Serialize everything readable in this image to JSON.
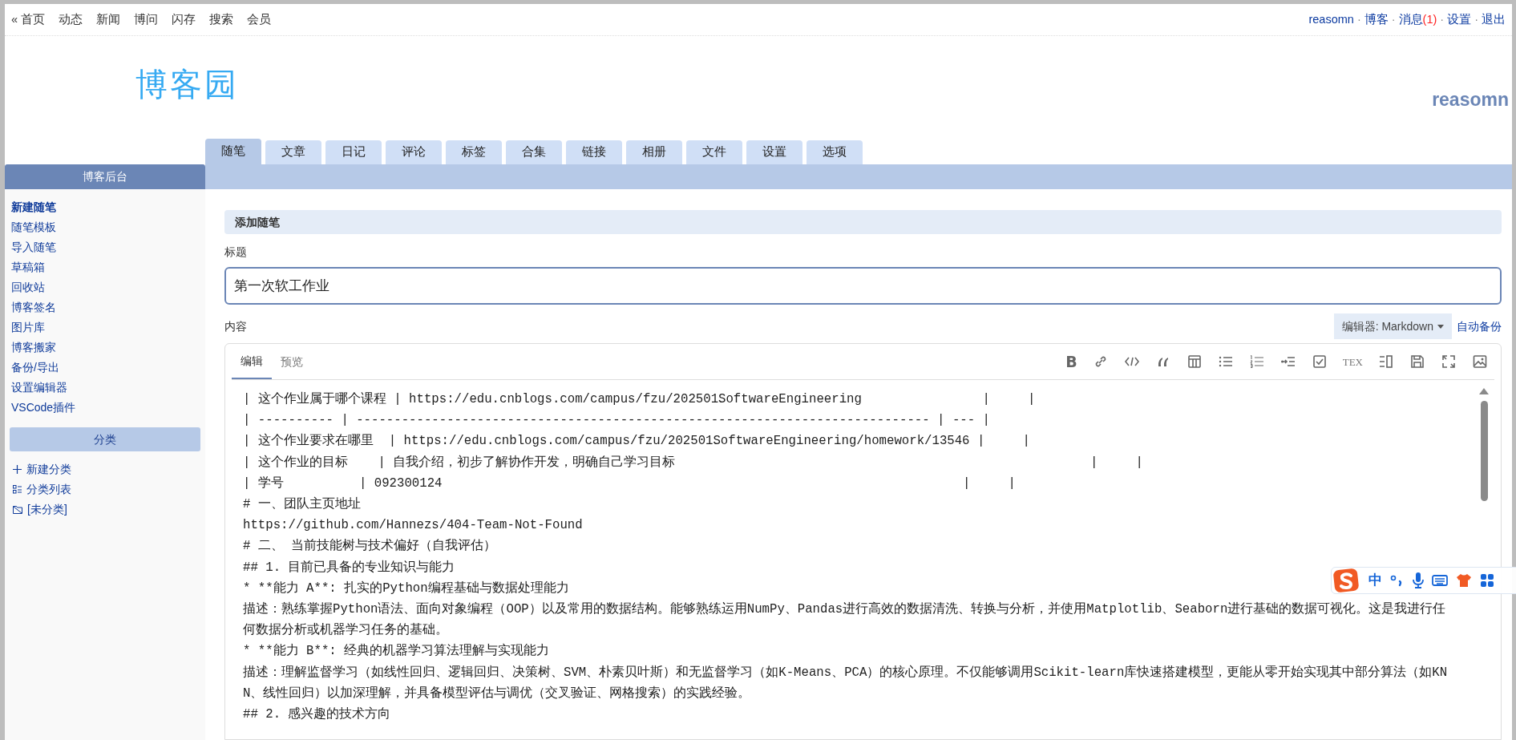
{
  "top_nav": {
    "left": [
      {
        "text": "« 首页"
      },
      {
        "text": "动态"
      },
      {
        "text": "新闻"
      },
      {
        "text": "博问"
      },
      {
        "text": "闪存"
      },
      {
        "text": "搜索"
      },
      {
        "text": "会员"
      }
    ],
    "right": [
      {
        "text": "reasomn"
      },
      {
        "text": "博客"
      },
      {
        "text": "消息",
        "count": "(1)"
      },
      {
        "text": "设置"
      },
      {
        "text": "退出"
      }
    ],
    "separator": "·"
  },
  "header": {
    "logo": "博客园",
    "username": "reasomn"
  },
  "tabs": [
    {
      "label": "随笔",
      "selected": true
    },
    {
      "label": "文章",
      "selected": false
    },
    {
      "label": "日记",
      "selected": false
    },
    {
      "label": "评论",
      "selected": false
    },
    {
      "label": "标签",
      "selected": false
    },
    {
      "label": "合集",
      "selected": false
    },
    {
      "label": "链接",
      "selected": false
    },
    {
      "label": "相册",
      "selected": false
    },
    {
      "label": "文件",
      "selected": false
    },
    {
      "label": "设置",
      "selected": false
    },
    {
      "label": "选项",
      "selected": false
    }
  ],
  "sidebar": {
    "title": "博客后台",
    "items": [
      {
        "label": "新建随笔",
        "selected": true
      },
      {
        "label": "随笔模板",
        "selected": false
      },
      {
        "label": "导入随笔",
        "selected": false
      },
      {
        "label": "草稿箱",
        "selected": false
      },
      {
        "label": "回收站",
        "selected": false
      },
      {
        "label": "博客签名",
        "selected": false
      },
      {
        "label": "图片库",
        "selected": false
      },
      {
        "label": "博客搬家",
        "selected": false
      },
      {
        "label": "备份/导出",
        "selected": false
      },
      {
        "label": "设置编辑器",
        "selected": false
      },
      {
        "label": "VSCode插件",
        "selected": false
      }
    ],
    "category_title": "分类",
    "categories": [
      {
        "kind": "add",
        "label": "新建分类"
      },
      {
        "kind": "list",
        "label": "分类列表"
      },
      {
        "kind": "folder",
        "label": "[未分类]"
      }
    ]
  },
  "form": {
    "section_title": "添加随笔",
    "title_label": "标题",
    "title_value": "第一次软工作业",
    "content_label": "内容",
    "editor_select": "编辑器: Markdown",
    "autosave_link": "自动备份"
  },
  "editor": {
    "tabs": [
      {
        "label": "编辑",
        "selected": true
      },
      {
        "label": "预览",
        "selected": false
      }
    ],
    "toolbar": [
      {
        "kind": "bold",
        "text": "B"
      },
      {
        "kind": "link"
      },
      {
        "kind": "code"
      },
      {
        "kind": "quote"
      },
      {
        "kind": "table"
      },
      {
        "kind": "bullet-list"
      },
      {
        "kind": "numbered-list"
      },
      {
        "kind": "indent"
      },
      {
        "kind": "checkbox"
      },
      {
        "kind": "tex",
        "text": "TEX"
      },
      {
        "kind": "split-view"
      },
      {
        "kind": "save"
      },
      {
        "kind": "fullscreen"
      },
      {
        "kind": "image"
      }
    ],
    "lines": [
      "| 这个作业属于哪个课程 | https://edu.cnblogs.com/campus/fzu/202501SoftwareEngineering                |     |",
      "| ---------- | ---------------------------------------------------------------------------- | --- |",
      "| 这个作业要求在哪里  | https://edu.cnblogs.com/campus/fzu/202501SoftwareEngineering/homework/13546 |     |",
      "| 这个作业的目标    | 自我介绍，初步了解协作开发，明确自己学习目标                                                       |     |",
      "| 学号          | 092300124                                                                     |     |",
      "# 一、团队主页地址",
      "https://github.com/Hannezs/404-Team-Not-Found",
      "# 二、 当前技能树与技术偏好（自我评估）",
      "## 1. 目前已具备的专业知识与能力",
      "* **能力 A**: 扎实的Python编程基础与数据处理能力",
      "描述：熟练掌握Python语法、面向对象编程（OOP）以及常用的数据结构。能够熟练运用NumPy、Pandas进行高效的数据清洗、转换与分析，并使用Matplotlib、Seaborn进行基础的数据可视化。这是我进行任何数据分析或机器学习任务的基础。",
      "* **能力 B**: 经典的机器学习算法理解与实现能力",
      "描述：理解监督学习（如线性回归、逻辑回归、决策树、SVM、朴素贝叶斯）和无监督学习（如K-Means、PCA）的核心原理。不仅能够调用Scikit-learn库快速搭建模型，更能从零开始实现其中部分算法（如KNN、线性回归）以加深理解，并具备模型评估与调优（交叉验证、网格搜索）的实践经验。",
      "## 2. 感兴趣的技术方向"
    ]
  },
  "ime_bar": {
    "mode": "中"
  }
}
